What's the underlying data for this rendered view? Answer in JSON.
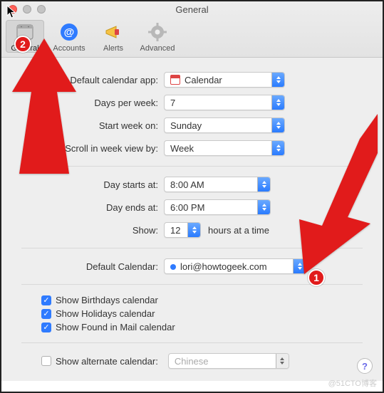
{
  "window": {
    "title": "General"
  },
  "toolbar": {
    "tabs": [
      {
        "id": "general",
        "label": "General",
        "selected": true
      },
      {
        "id": "accounts",
        "label": "Accounts",
        "selected": false
      },
      {
        "id": "alerts",
        "label": "Alerts",
        "selected": false
      },
      {
        "id": "advanced",
        "label": "Advanced",
        "selected": false
      }
    ]
  },
  "labels": {
    "default_app": "Default calendar app:",
    "days_per_week": "Days per week:",
    "start_week": "Start week on:",
    "scroll_week": "Scroll in week view by:",
    "day_starts": "Day starts at:",
    "day_ends": "Day ends at:",
    "show": "Show:",
    "hours_at_a_time": "hours at a time",
    "default_cal": "Default Calendar:",
    "alt_cal": "Show alternate calendar:"
  },
  "values": {
    "default_app": "Calendar",
    "days_per_week": "7",
    "start_week": "Sunday",
    "scroll_week": "Week",
    "day_starts": "8:00 AM",
    "day_ends": "6:00 PM",
    "show_hours": "12",
    "default_cal": "lori@howtogeek.com",
    "alt_cal": "Chinese"
  },
  "checkboxes": {
    "birthdays": {
      "label": "Show Birthdays calendar",
      "checked": true
    },
    "holidays": {
      "label": "Show Holidays calendar",
      "checked": true
    },
    "found_mail": {
      "label": "Show Found in Mail calendar",
      "checked": true
    },
    "alternate": {
      "checked": false
    }
  },
  "annotations": {
    "badge1": "1",
    "badge2": "2"
  },
  "watermark": "@51CTO博客"
}
